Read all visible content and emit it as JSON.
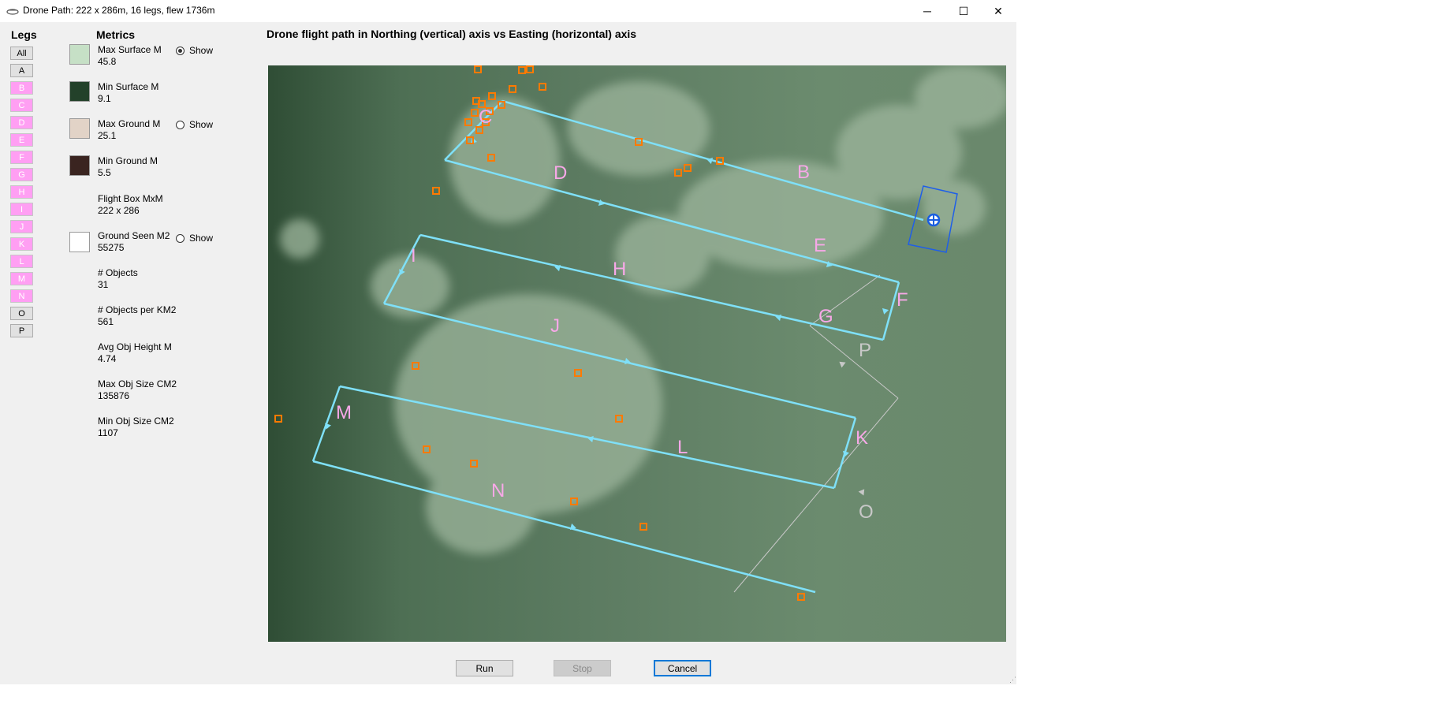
{
  "window": {
    "title": "Drone Path: 222 x 286m, 16 legs, flew 1736m",
    "icon": "drone-icon",
    "controls": {
      "minimize": "─",
      "maximize": "☐",
      "close": "✕"
    }
  },
  "legs": {
    "heading": "Legs",
    "buttons": [
      {
        "label": "All",
        "style": "gray"
      },
      {
        "label": "A",
        "style": "gray"
      },
      {
        "label": "B",
        "style": "pink"
      },
      {
        "label": "C",
        "style": "pink"
      },
      {
        "label": "D",
        "style": "pink"
      },
      {
        "label": "E",
        "style": "pink"
      },
      {
        "label": "F",
        "style": "pink"
      },
      {
        "label": "G",
        "style": "pink"
      },
      {
        "label": "H",
        "style": "pink"
      },
      {
        "label": "I",
        "style": "pink"
      },
      {
        "label": "J",
        "style": "pink"
      },
      {
        "label": "K",
        "style": "pink"
      },
      {
        "label": "L",
        "style": "pink"
      },
      {
        "label": "M",
        "style": "pink"
      },
      {
        "label": "N",
        "style": "pink"
      },
      {
        "label": "O",
        "style": "gray"
      },
      {
        "label": "P",
        "style": "gray"
      }
    ]
  },
  "metrics": {
    "heading": "Metrics",
    "items": [
      {
        "label": "Max Surface M",
        "value": "45.8",
        "swatch": "#c6e0c6",
        "radio": "Show",
        "checked": true
      },
      {
        "label": "Min Surface M",
        "value": "9.1",
        "swatch": "#23412a"
      },
      {
        "label": "Max Ground M",
        "value": "25.1",
        "swatch": "#e2d3c7",
        "radio": "Show",
        "checked": false
      },
      {
        "label": "Min Ground M",
        "value": "5.5",
        "swatch": "#3a2420"
      },
      {
        "label": "Flight Box MxM",
        "value": "222 x 286"
      },
      {
        "label": "Ground Seen M2",
        "value": "55275",
        "swatch": "#ffffff",
        "radio": "Show",
        "checked": false
      },
      {
        "label": "# Objects",
        "value": "31"
      },
      {
        "label": "# Objects per KM2",
        "value": "561"
      },
      {
        "label": "Avg Obj Height M",
        "value": "4.74"
      },
      {
        "label": "Max Obj Size CM2",
        "value": "135876"
      },
      {
        "label": "Min Obj Size CM2",
        "value": "1107"
      }
    ]
  },
  "chart": {
    "title": "Drone flight path in Northing (vertical) axis vs Easting (horizontal) axis",
    "leg_labels": [
      "B",
      "C",
      "D",
      "E",
      "F",
      "G",
      "H",
      "I",
      "J",
      "K",
      "L",
      "M",
      "N",
      "O",
      "P"
    ],
    "colors": {
      "path": "#7fe0f8",
      "label": "#f8a8e8",
      "returnPath": "#c8c8c8",
      "object": "#ff7a00",
      "drone": "#1a5ee0"
    }
  },
  "buttons": {
    "run": "Run",
    "stop": "Stop",
    "cancel": "Cancel"
  }
}
